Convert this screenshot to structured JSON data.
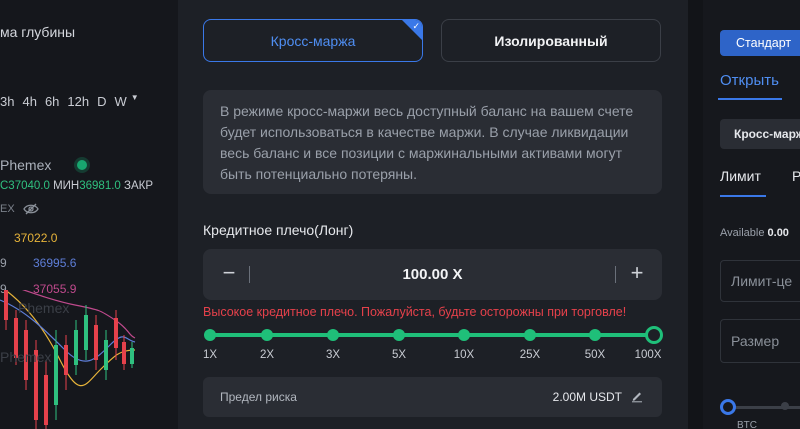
{
  "chart_panel": {
    "depth_title": "ма глубины",
    "timeframes": [
      "3h",
      "4h",
      "6h",
      "12h",
      "D",
      "W"
    ],
    "symbol": "Phemex",
    "ohlc": {
      "close_value": "C37040.0",
      "low_label": "МИН",
      "low_value": "36981.0",
      "close_label": "ЗАКР"
    },
    "ex_label": "EX",
    "ma_lines": [
      {
        "prefix": "",
        "value": "37022.0"
      },
      {
        "prefix": "9",
        "value": "36995.6"
      },
      {
        "prefix": "9",
        "value": "37055.9"
      }
    ],
    "watermark_1": "Phemex",
    "watermark_2": "Phemex",
    "colors": {
      "up": "#2fc07f",
      "down": "#e5414b",
      "ma1": "#e7b43a",
      "ma2": "#5e7ed8",
      "ma3": "#c04a8d"
    }
  },
  "modal": {
    "mode_buttons": {
      "cross": "Кросс-маржа",
      "isolated": "Изолированный",
      "selected": "cross"
    },
    "info_text": "В режиме кросс-маржи весь доступный баланс на вашем счете будет использоваться в качестве маржи. В случае ликвидации весь баланс и все позиции с маржинальными активами могут быть потенциально потеряны.",
    "leverage": {
      "label": "Кредитное плечо(Лонг)",
      "value": "100.00 X",
      "minus": "−",
      "plus": "+",
      "warning": "Высокое кредитное плечо. Пожалуйста, будьте осторожны при торговле!",
      "ticks": [
        "1X",
        "2X",
        "3X",
        "5X",
        "10X",
        "25X",
        "50X",
        "100X"
      ],
      "selected_index": 7
    },
    "risk_limit": {
      "label": "Предел риска",
      "value": "2.00M USDT"
    },
    "colors": {
      "accent": "#3a78e8",
      "slider": "#1fbf79",
      "warning": "#e5414b"
    }
  },
  "order_panel": {
    "standard_button": "Стандарт",
    "tab_open": "Открыть",
    "margin_select": "Кросс-марж",
    "tab_limit": "Лимит",
    "tab_market": "Р",
    "available_label": "Available",
    "available_value": "0.00",
    "price_placeholder": "Лимит-це",
    "size_placeholder": "Размер",
    "bottom_label": "BTC"
  }
}
